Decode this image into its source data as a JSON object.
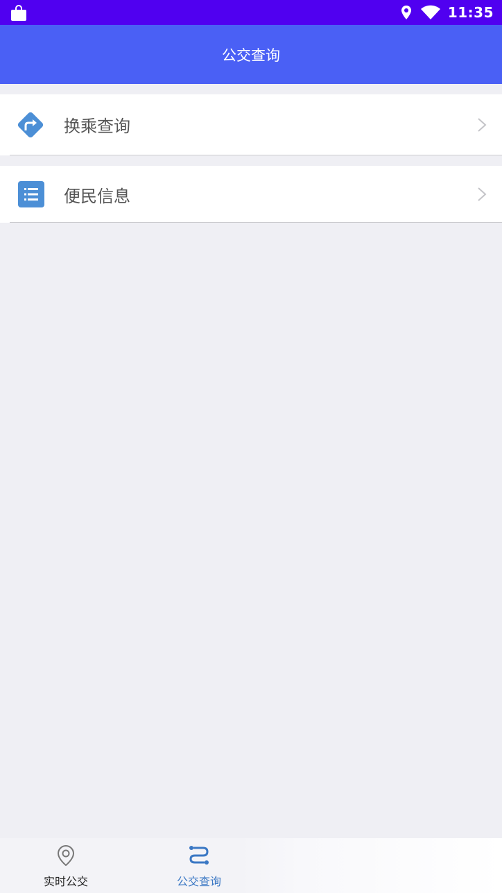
{
  "status_bar": {
    "time": "11:35",
    "icons": [
      "shopping-bag-icon",
      "location-pin-icon",
      "wifi-icon"
    ]
  },
  "header": {
    "title": "公交查询"
  },
  "menu": {
    "items": [
      {
        "label": "换乘查询",
        "icon": "route-turn-icon"
      },
      {
        "label": "便民信息",
        "icon": "list-icon"
      }
    ]
  },
  "tab_bar": {
    "tabs": [
      {
        "label": "实时公交",
        "icon": "map-pin-outline-icon",
        "active": false
      },
      {
        "label": "公交查询",
        "icon": "route-icon",
        "active": true
      }
    ]
  },
  "colors": {
    "status_bar": "#5000f0",
    "header": "#4a60f5",
    "page_background": "#efeff4",
    "icon_blue": "#4c8fd6",
    "tab_active": "#3b78c4",
    "tab_inactive": "#222222"
  }
}
